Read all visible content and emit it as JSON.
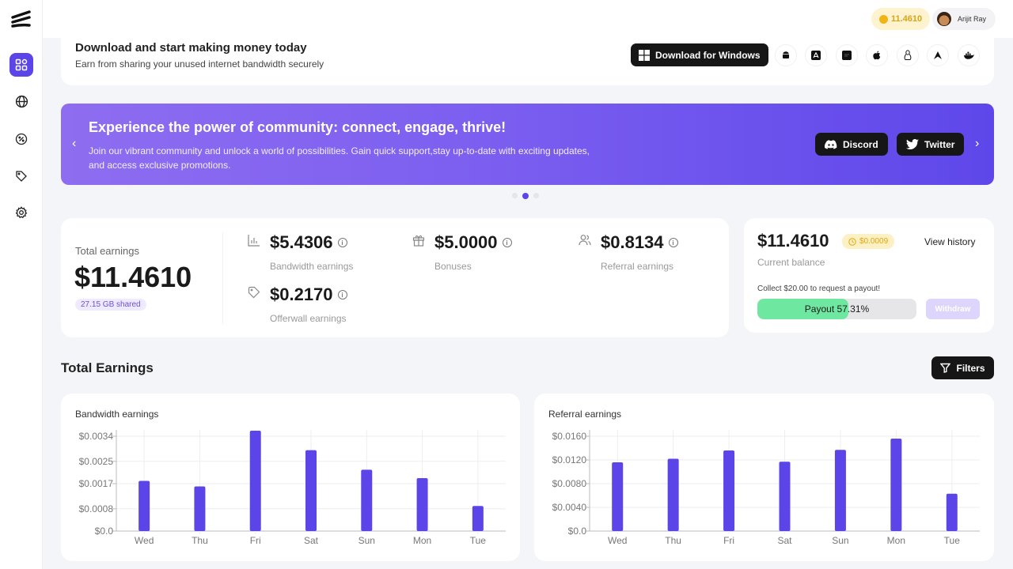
{
  "sidebar": {
    "logo": "layers-logo",
    "items": [
      {
        "name": "dashboard",
        "icon": "grid-icon",
        "active": true
      },
      {
        "name": "proxy",
        "icon": "globe-icon",
        "active": false
      },
      {
        "name": "speed",
        "icon": "gauge-icon",
        "active": false
      },
      {
        "name": "offers",
        "icon": "tag-icon",
        "active": false
      },
      {
        "name": "settings",
        "icon": "gear-icon",
        "active": false
      }
    ]
  },
  "header": {
    "balance": "11.4610",
    "user_name": "Arijit Ray"
  },
  "download": {
    "title": "Download and start making money today",
    "subtitle": "Earn from sharing your unused internet bandwidth securely",
    "windows_label": "Download for Windows",
    "platforms": [
      "android",
      "app-store",
      "raspberry-pi",
      "apple",
      "linux",
      "arch",
      "docker"
    ]
  },
  "banner": {
    "title": "Experience the power of community: connect, engage, thrive!",
    "text": "Join our vibrant community and unlock a world of possibilities. Gain quick support,stay up-to-date with exciting updates, and access exclusive promotions.",
    "discord_label": "Discord",
    "twitter_label": "Twitter",
    "slides": 3,
    "active_slide": 1
  },
  "earnings": {
    "total_label": "Total earnings",
    "total_value": "$11.4610",
    "shared": "27.15 GB shared",
    "bandwidth": {
      "value": "$5.4306",
      "label": "Bandwidth earnings"
    },
    "offerwall": {
      "value": "$0.2170",
      "label": "Offerwall earnings"
    },
    "bonuses": {
      "value": "$5.0000",
      "label": "Bonuses"
    },
    "referral": {
      "value": "$0.8134",
      "label": "Referral earnings"
    }
  },
  "balance": {
    "value": "$11.4610",
    "pending": "$0.0009",
    "view_history": "View history",
    "label": "Current balance",
    "collect_text": "Collect $20.00 to request a payout!",
    "payout_label": "Payout 57.31%",
    "payout_percent": 57.31,
    "withdraw_label": "Withdraw"
  },
  "section": {
    "title": "Total Earnings",
    "filters_label": "Filters"
  },
  "chart_data": [
    {
      "type": "bar",
      "title": "Bandwidth earnings",
      "categories": [
        "Wed",
        "Thu",
        "Fri",
        "Sat",
        "Sun",
        "Mon",
        "Tue"
      ],
      "values": [
        0.0018,
        0.0016,
        0.0036,
        0.0029,
        0.0022,
        0.0019,
        0.0009
      ],
      "yticks": [
        0,
        0.0008,
        0.0017,
        0.0025,
        0.0034
      ],
      "ytick_labels": [
        "$0.0",
        "$0.0008",
        "$0.0017",
        "$0.0025",
        "$0.0034"
      ],
      "ylim": [
        0,
        0.0036
      ],
      "xlabel": "",
      "ylabel": "",
      "grid": true,
      "color": "#5b45e8"
    },
    {
      "type": "bar",
      "title": "Referral earnings",
      "categories": [
        "Wed",
        "Thu",
        "Fri",
        "Sat",
        "Sun",
        "Mon",
        "Tue"
      ],
      "values": [
        0.0116,
        0.0122,
        0.0136,
        0.0117,
        0.0137,
        0.0156,
        0.0063
      ],
      "yticks": [
        0,
        0.004,
        0.008,
        0.012,
        0.016
      ],
      "ytick_labels": [
        "$0.0",
        "$0.0040",
        "$0.0080",
        "$0.0120",
        "$0.0160"
      ],
      "ylim": [
        0,
        0.016
      ],
      "xlabel": "",
      "ylabel": "",
      "grid": true,
      "color": "#5b45e8"
    }
  ]
}
